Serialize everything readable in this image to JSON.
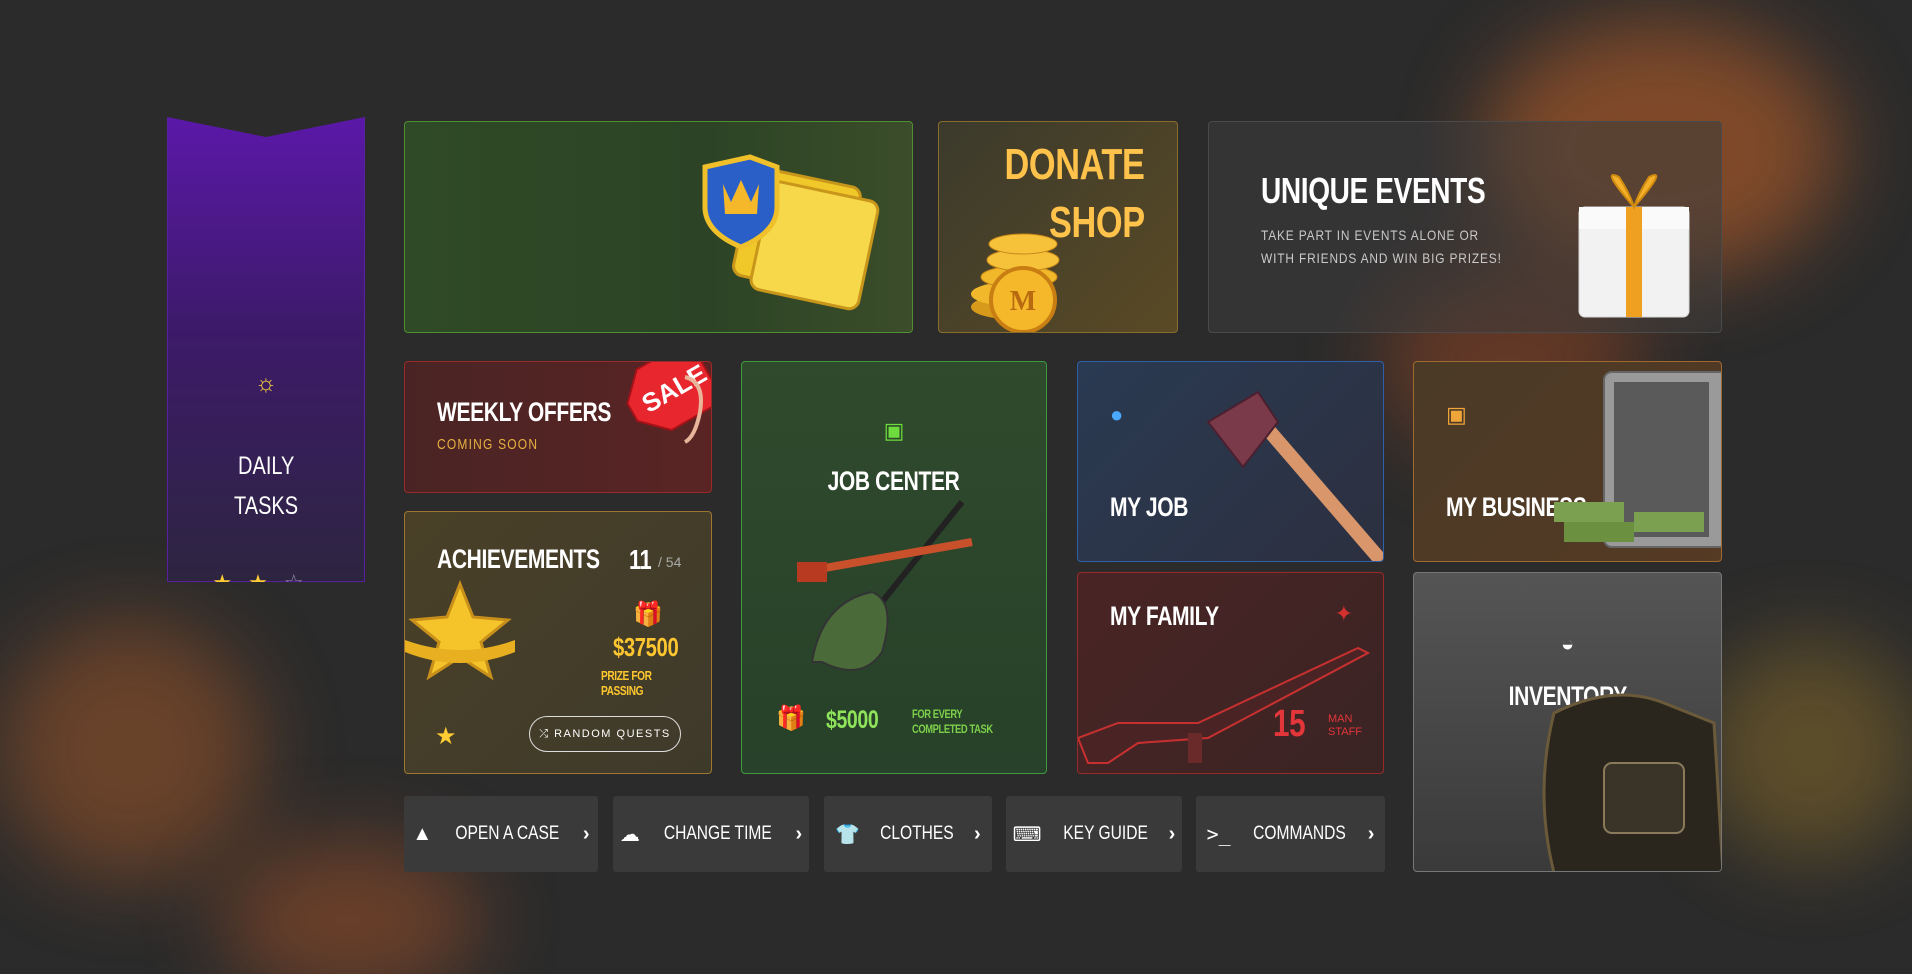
{
  "colors": {
    "background": "#2b2b2b",
    "daily_accent": "#5b18a8",
    "pass_border": "#4f8f2f",
    "donate_text": "#ffc24a",
    "weekly_border": "#9a2a2a",
    "achievements_border": "#9e7632",
    "job_accent": "#6ddc3c",
    "myjob_accent": "#4aa8ff",
    "business_accent": "#f0a53a",
    "family_accent": "#e2363a"
  },
  "daily": {
    "icon": "sun-icon",
    "line1": "DAILY",
    "line2": "TASKS",
    "stars_filled": 2,
    "stars_total": 3
  },
  "donate": {
    "line1": "DONATE",
    "line2": "SHOP"
  },
  "events": {
    "title": "UNIQUE EVENTS",
    "desc1": "TAKE PART IN EVENTS ALONE OR",
    "desc2": "WITH FRIENDS AND WIN BIG PRIZES!"
  },
  "weekly": {
    "title": "WEEKLY OFFERS",
    "subtitle": "COMING SOON",
    "tag": "SALE"
  },
  "achievements": {
    "title": "ACHIEVEMENTS",
    "count": "11",
    "total": "/ 54",
    "amount": "$37500",
    "prize_label": "PRIZE FOR PASSING",
    "button": "RANDOM QUESTS"
  },
  "job_center": {
    "title": "JOB CENTER",
    "amount": "$5000",
    "note1": "FOR EVERY",
    "note2": "COMPLETED TASK"
  },
  "my_job": {
    "title": "MY JOB"
  },
  "my_business": {
    "title": "MY BUSINESS"
  },
  "my_family": {
    "title": "MY FAMILY",
    "count": "15",
    "staff1": "MAN",
    "staff2": "STAFF"
  },
  "inventory": {
    "title": "INVENTORY"
  },
  "bottom": [
    {
      "label": "OPEN A CASE",
      "icon": "warning-icon"
    },
    {
      "label": "CHANGE TIME",
      "icon": "weather-icon"
    },
    {
      "label": "CLOTHES",
      "icon": "shirt-icon"
    },
    {
      "label": "KEY GUIDE",
      "icon": "keyboard-icon"
    },
    {
      "label": "COMMANDS",
      "icon": "terminal-icon"
    }
  ]
}
